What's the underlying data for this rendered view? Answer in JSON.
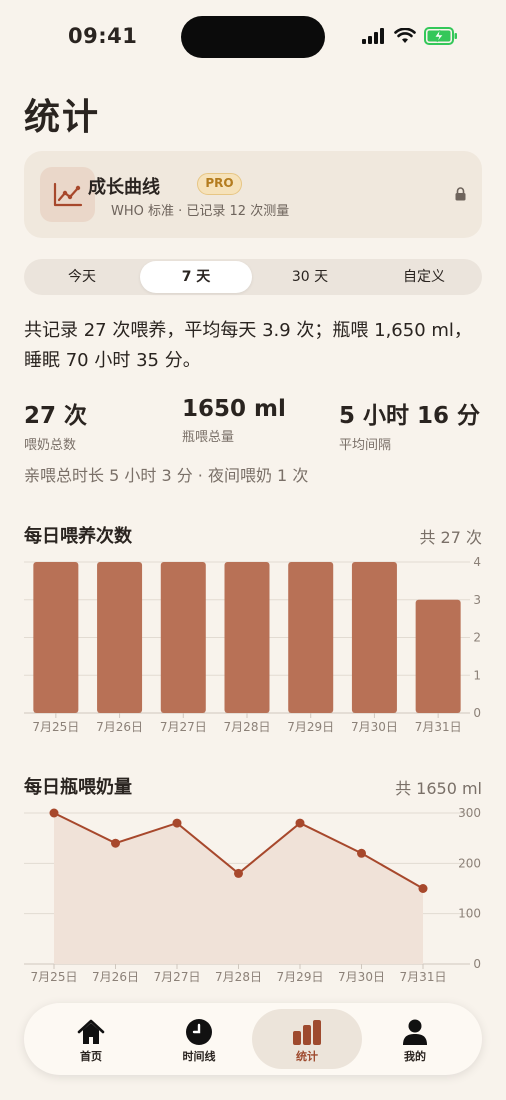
{
  "status_bar": {
    "time": "09:41"
  },
  "page": {
    "title": "统计"
  },
  "growth": {
    "title": "成长曲线",
    "badge": "PRO",
    "subtitle": "WHO 标准 · 已记录 12 次测量"
  },
  "ranges": {
    "options": [
      "今天",
      "7 天",
      "30 天",
      "自定义"
    ],
    "selected": "7 天"
  },
  "summary": {
    "line1": "共记录 27 次喂养，平均每天 3.9 次；瓶喂 1,650 ml，",
    "line2": "睡眠 70 小时 35 分。"
  },
  "stats": [
    {
      "value": "27 次",
      "label": "喂奶总数"
    },
    {
      "value": "1650 ml",
      "label": "瓶喂总量"
    },
    {
      "value": "5 小时 16 分",
      "label": "平均间隔"
    }
  ],
  "extra": "亲喂总时长 5 小时 3 分 · 夜间喂奶 1 次",
  "chart1_header": {
    "title": "每日喂养次数",
    "total": "共 27 次"
  },
  "chart2_header": {
    "title": "每日瓶喂奶量",
    "total": "共 1650 ml"
  },
  "chart_data": [
    {
      "type": "bar",
      "title": "每日喂养次数",
      "categories": [
        "7月25日",
        "7月26日",
        "7月27日",
        "7月28日",
        "7月29日",
        "7月30日",
        "7月31日"
      ],
      "values": [
        4,
        4,
        4,
        4,
        4,
        4,
        3
      ],
      "ylim": [
        0,
        4
      ],
      "yticks": [
        "0",
        "1",
        "2",
        "3",
        "4"
      ],
      "grid": true,
      "color": "#b87156"
    },
    {
      "type": "area",
      "title": "每日瓶喂奶量",
      "categories": [
        "7月25日",
        "7月26日",
        "7月27日",
        "7月28日",
        "7月29日",
        "7月30日",
        "7月31日"
      ],
      "values": [
        300,
        240,
        280,
        180,
        280,
        220,
        150
      ],
      "ylim": [
        0,
        300
      ],
      "yticks": [
        "0",
        "100",
        "200",
        "300"
      ],
      "grid": true,
      "color": "#a7482c",
      "fill": "#f0e2d8"
    }
  ],
  "tabbar": [
    {
      "label": "首页",
      "icon": "home-icon"
    },
    {
      "label": "时间线",
      "icon": "clock-icon"
    },
    {
      "label": "统计",
      "icon": "bar-chart-icon",
      "active": true
    },
    {
      "label": "我的",
      "icon": "person-icon"
    }
  ],
  "colors": {
    "accent": "#a7482c",
    "bar": "#b87156",
    "background": "#f8f3ec"
  }
}
